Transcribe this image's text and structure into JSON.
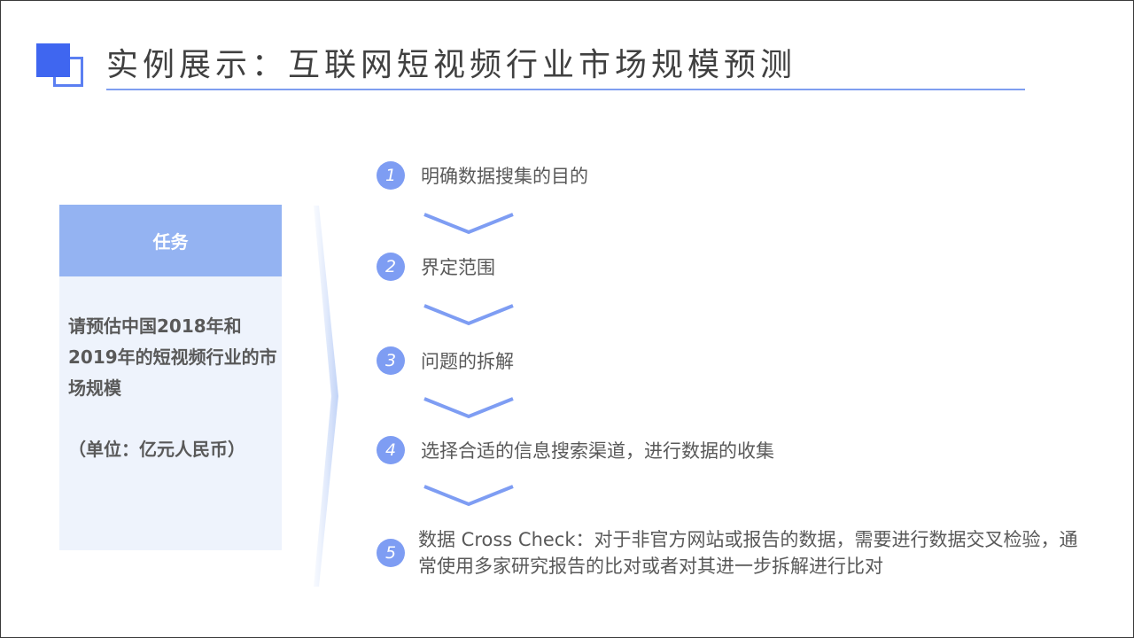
{
  "header": {
    "title": "实例展示：互联网短视频行业市场规模预测"
  },
  "task": {
    "heading": "任务",
    "body": "请预估中国2018年和2019年的短视频行业的市场规模",
    "unit": "（单位：亿元人民币）"
  },
  "steps": [
    {
      "number": "1",
      "text": "明确数据搜集的目的"
    },
    {
      "number": "2",
      "text": "界定范围"
    },
    {
      "number": "3",
      "text": "问题的拆解"
    },
    {
      "number": "4",
      "text": "选择合适的信息搜索渠道，进行数据的收集"
    },
    {
      "number": "5",
      "text": "数据 Cross Check：对于非官方网站或报告的数据，需要进行数据交叉检验，通常使用多家研究报告的比对或者对其进一步拆解进行比对"
    }
  ],
  "colors": {
    "accent": "#3f66f0",
    "step_circle": "#7e9df3",
    "task_header": "#94b3f2",
    "task_panel": "#eef3fc",
    "rule": "#7f9ef0"
  },
  "icons": {
    "logo": "overlapping-squares-icon",
    "flow_arrow": "chevron-down-icon",
    "panel_separator": "angle-bracket-icon"
  }
}
